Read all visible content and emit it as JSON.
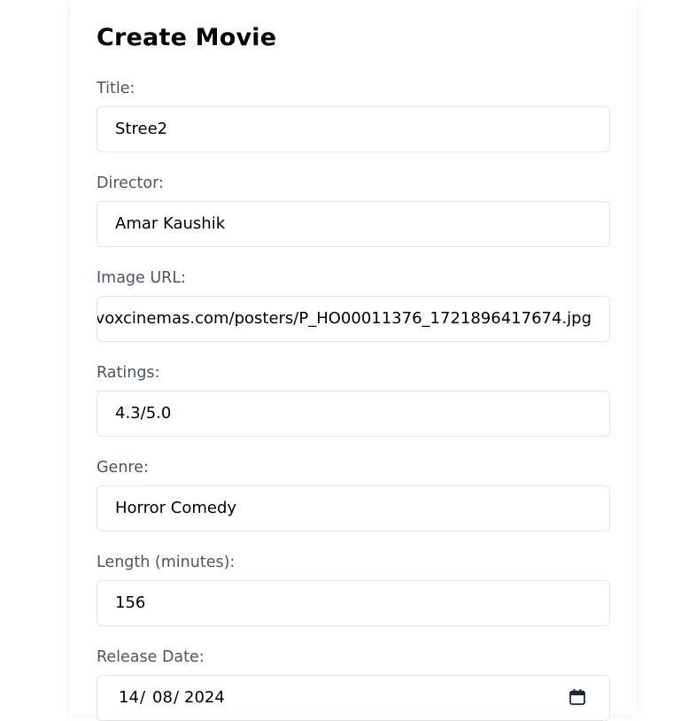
{
  "form": {
    "title": "Create Movie",
    "fields": [
      {
        "label": "Title:",
        "value": "Stree2"
      },
      {
        "label": "Director:",
        "value": "Amar Kaushik"
      },
      {
        "label": "Image URL:",
        "value": "voxcinemas.com/posters/P_HO00011376_1721896417674.jpg"
      },
      {
        "label": "Ratings:",
        "value": "4.3/5.0"
      },
      {
        "label": "Genre:",
        "value": "Horror Comedy"
      },
      {
        "label": "Length (minutes):",
        "value": "156"
      }
    ],
    "release_date": {
      "label": "Release Date:",
      "day": "14",
      "month": "08",
      "year": "2024",
      "separator": "/"
    }
  },
  "icons": {
    "calendar": "calendar-icon"
  },
  "colors": {
    "label_text": "#4b5563",
    "input_border": "#e2e5e9",
    "title_text": "#000000"
  }
}
